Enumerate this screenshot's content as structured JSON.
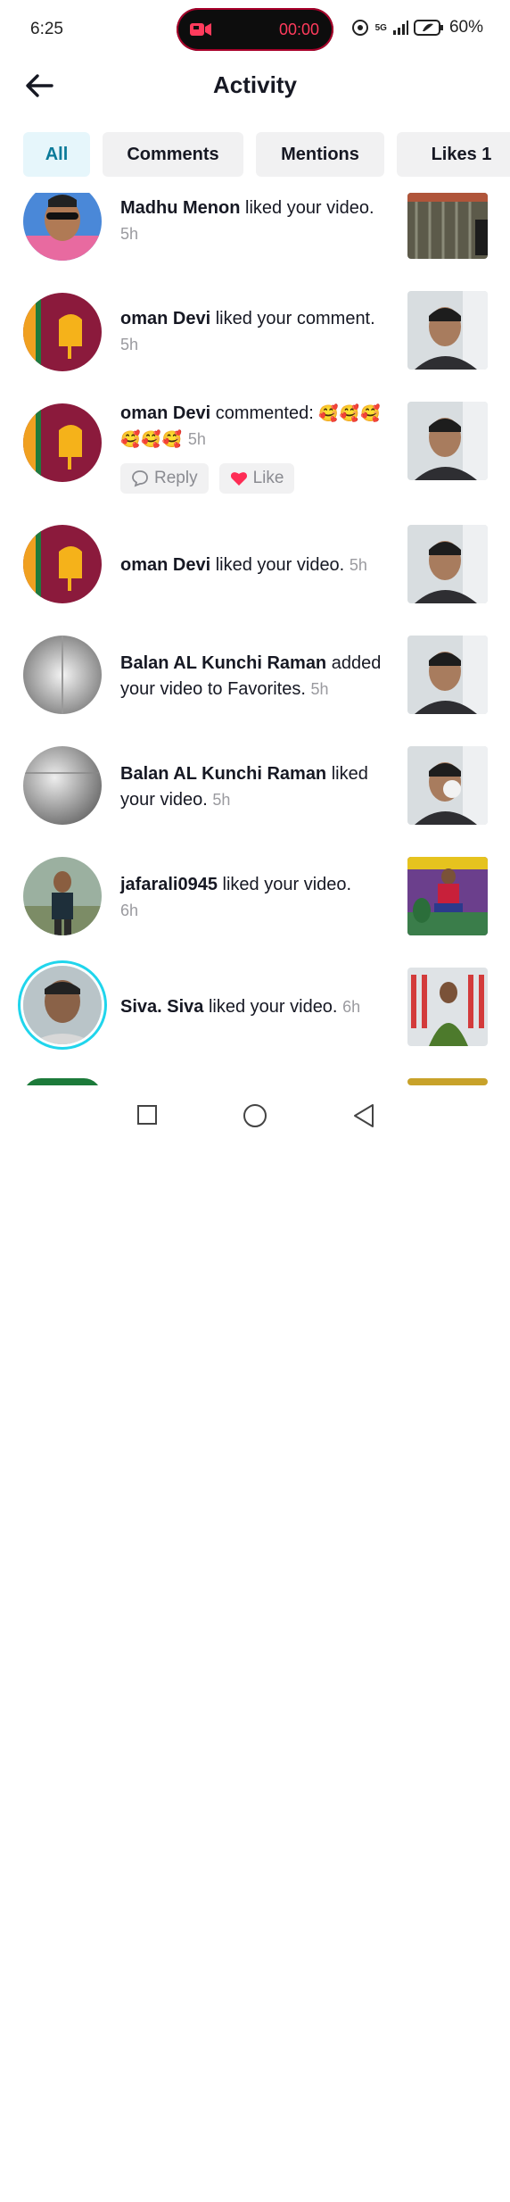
{
  "status": {
    "time": "6:25",
    "recording_timer": "00:00",
    "network": "5G",
    "battery": "60%"
  },
  "header": {
    "title": "Activity"
  },
  "tabs": [
    {
      "label": "All"
    },
    {
      "label": "Comments"
    },
    {
      "label": "Mentions"
    },
    {
      "label": "Likes 1"
    }
  ],
  "items": [
    {
      "user": "Madhu Menon",
      "action": "liked your video.",
      "time": "5h",
      "avatar": "man-sunglasses",
      "thumb": "gate"
    },
    {
      "user": "oman Devi",
      "action": "liked your comment.",
      "time": "5h",
      "avatar": "sri-lanka-flag",
      "thumb": "man-portrait"
    },
    {
      "user": "oman Devi",
      "action": "commented:",
      "emoji": "🥰🥰🥰🥰🥰🥰",
      "time": "5h",
      "avatar": "sri-lanka-flag",
      "thumb": "man-portrait",
      "reply_label": "Reply",
      "like_label": "Like"
    },
    {
      "user": "oman Devi",
      "action": "liked your video.",
      "time": "5h",
      "avatar": "sri-lanka-flag",
      "thumb": "man-portrait"
    },
    {
      "user": "Balan AL Kunchi Raman",
      "action": "added your video to Favorites.",
      "time": "5h",
      "avatar": "grey-blur",
      "thumb": "man-portrait"
    },
    {
      "user": "Balan AL Kunchi Raman",
      "action": "liked your video.",
      "time": "5h",
      "avatar": "grey-blur",
      "thumb": "man-portrait"
    },
    {
      "user": "jafarali0945",
      "action": "liked your video.",
      "time": "6h",
      "avatar": "man-standing",
      "thumb": "seated-group"
    },
    {
      "user": "Siva. Siva",
      "action": "liked your video.",
      "time": "6h",
      "avatar": "boy-ring",
      "thumb": "man-jersey"
    }
  ],
  "colors": {
    "accent": "#20d5ec",
    "tab_active_bg": "#e6f6fb",
    "tab_active_text": "#0b7a99",
    "like": "#fe2c55",
    "rec": "#ff3b5c"
  },
  "icons": {
    "back": "arrow-left-icon",
    "reply": "speech-bubble-icon",
    "like": "heart-icon",
    "nav_recent": "square-icon",
    "nav_home": "circle-icon",
    "nav_back": "triangle-back-icon"
  }
}
